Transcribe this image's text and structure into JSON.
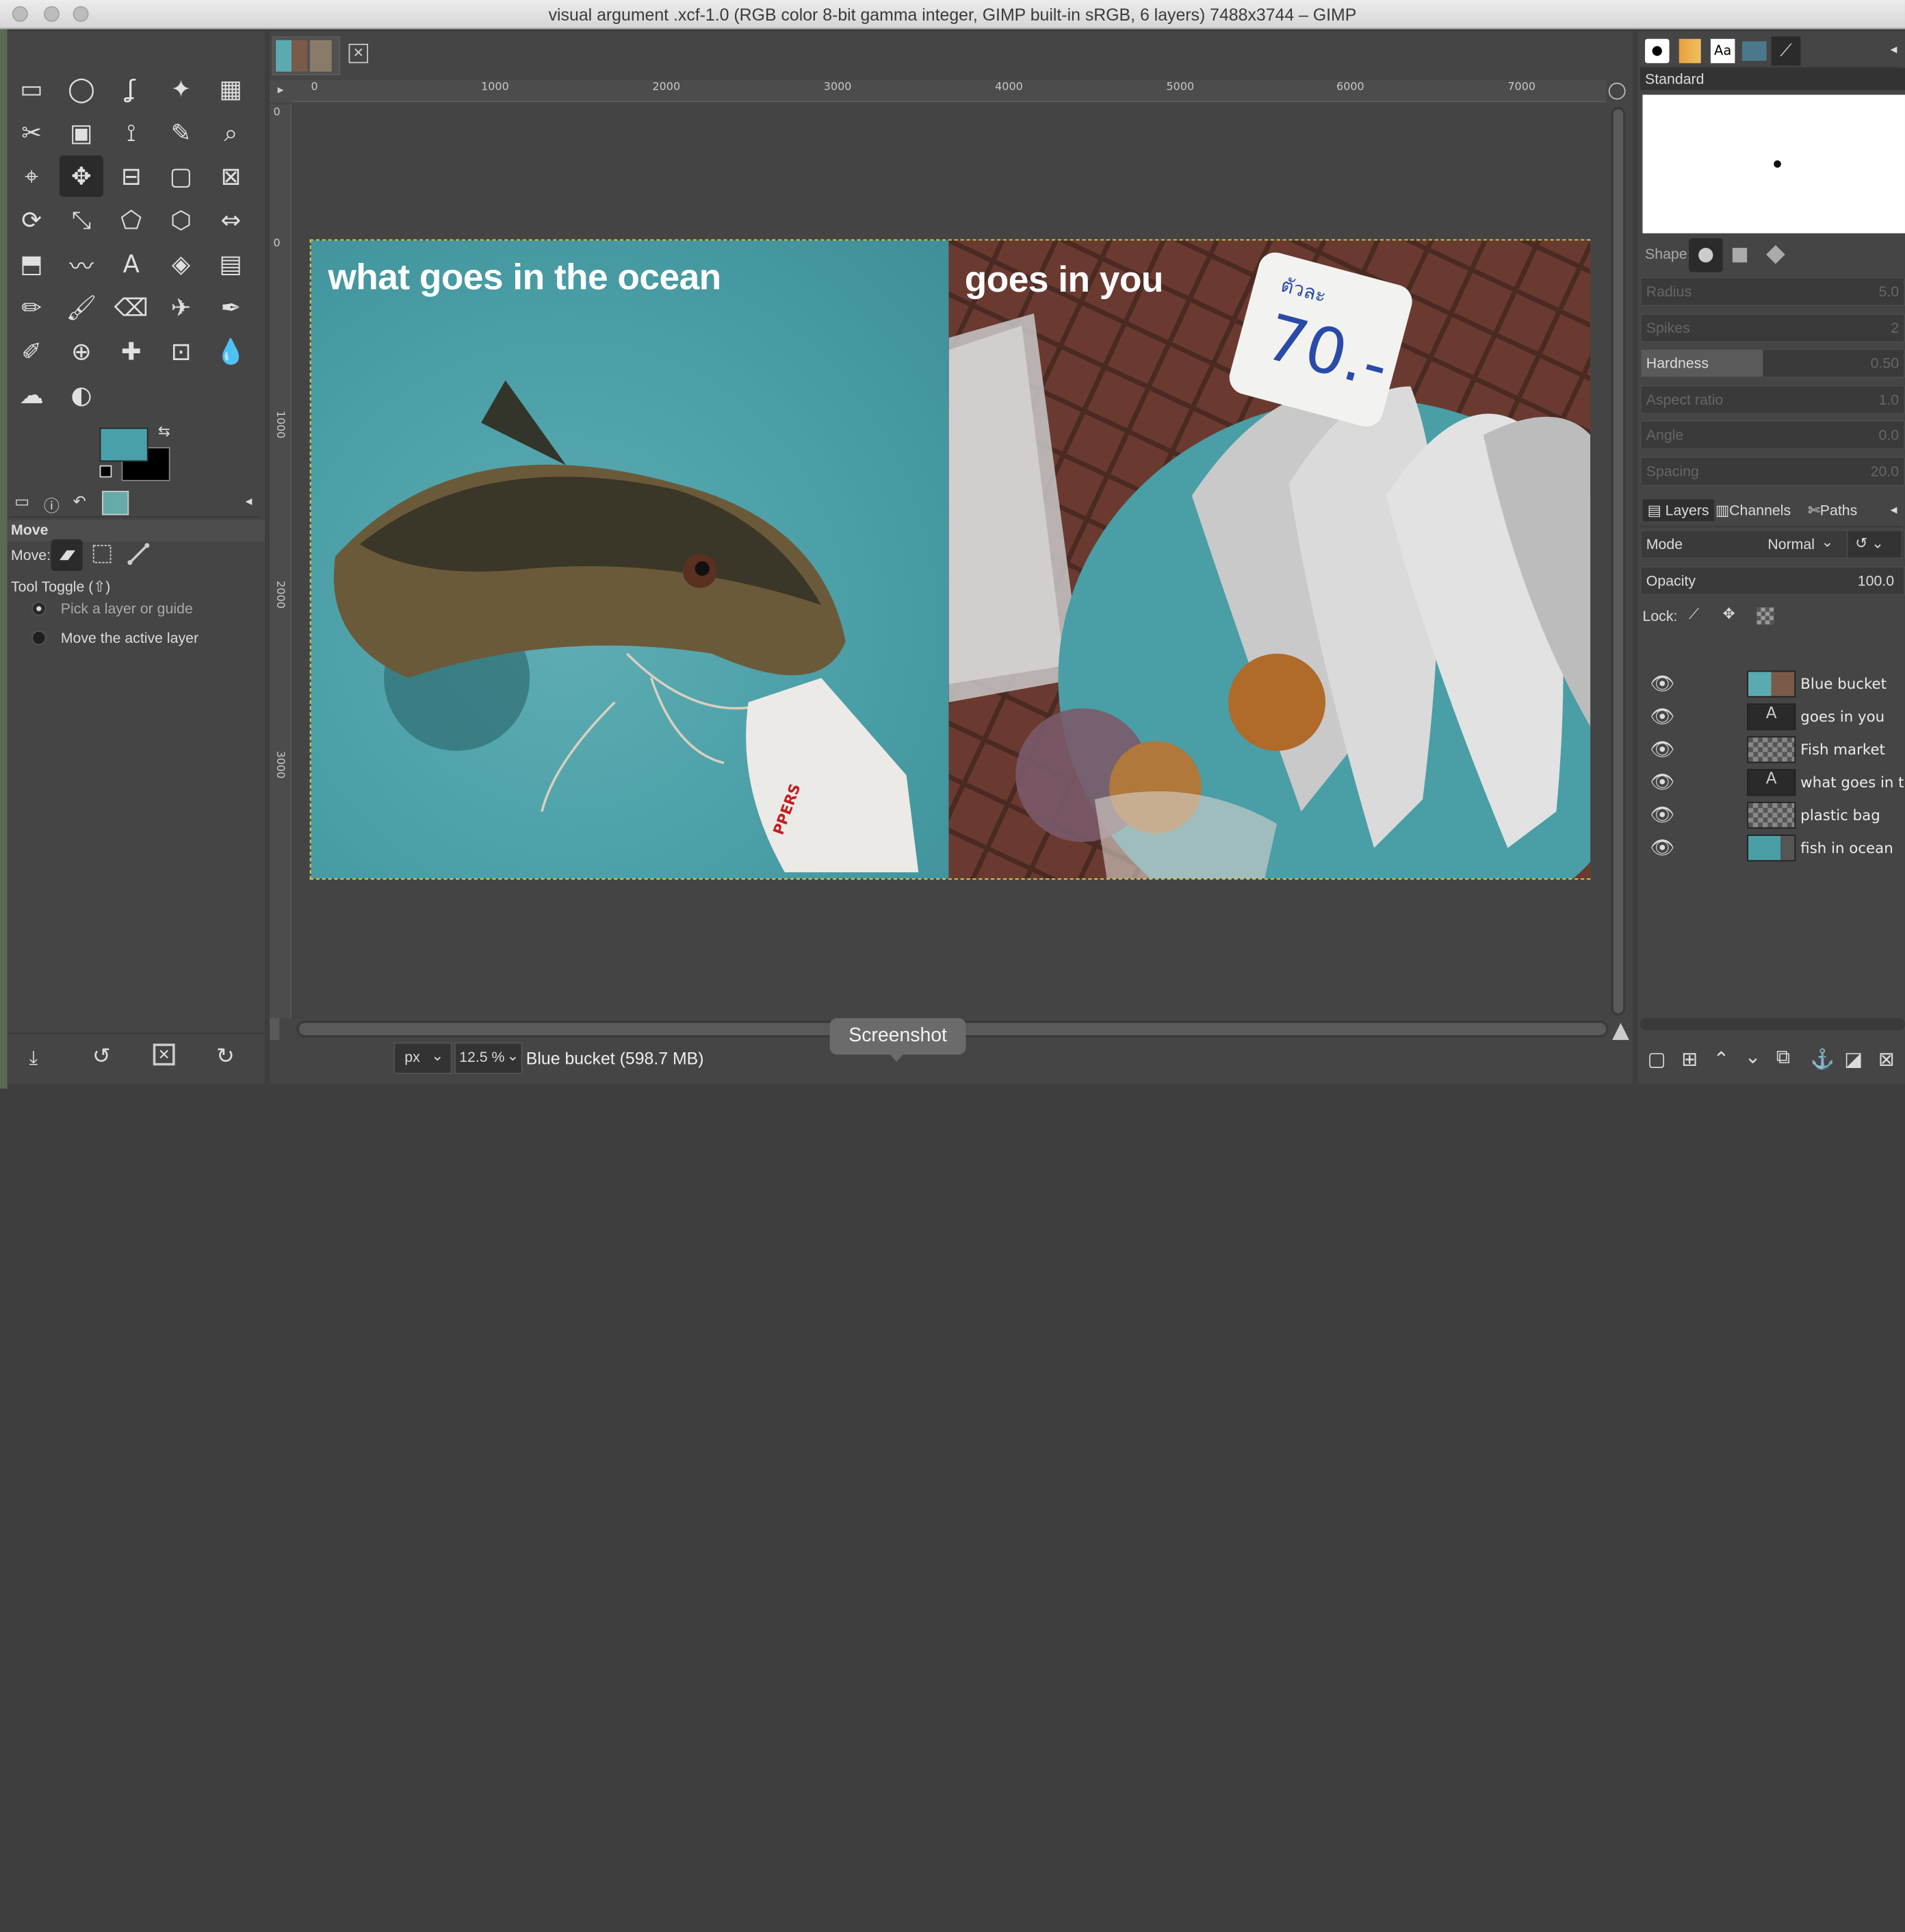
{
  "window": {
    "title": "visual argument .xcf-1.0 (RGB color 8-bit gamma integer, GIMP built-in sRGB, 6 layers) 7488x3744 – GIMP"
  },
  "ruler": {
    "h_labels": [
      "0",
      "1000",
      "2000",
      "3000",
      "4000",
      "5000",
      "6000",
      "7000"
    ],
    "v_labels": [
      "0",
      "1000",
      "2000",
      "3000"
    ]
  },
  "toolbox": {
    "tools": [
      "rect-select",
      "ellipse-select",
      "free-select",
      "fuzzy-select",
      "color-select",
      "scissors",
      "foreground-select",
      "paths",
      "color-picker",
      "zoom",
      "measure",
      "move",
      "align",
      "crop",
      "unified-transform",
      "rotate",
      "scale",
      "perspective",
      "3d-transform",
      "flip",
      "cage",
      "warp",
      "text",
      "bucket-fill",
      "blend",
      "pencil",
      "paintbrush",
      "eraser",
      "airbrush",
      "ink",
      "mypaint",
      "clone",
      "heal",
      "perspective-clone",
      "blur",
      "smudge",
      "dodge"
    ],
    "fg_color": "#4aa0a8",
    "bg_color": "#000000"
  },
  "tool_options": {
    "title": "Move",
    "move_label": "Move:",
    "toggle_label": "Tool Toggle  (⇧)",
    "options": [
      "Pick a layer or guide",
      "Move the active layer"
    ]
  },
  "canvas": {
    "left_caption": "what goes in the ocean",
    "right_caption": "goes in you",
    "price_tag": "70.-",
    "price_tag_word": "ตัวละ"
  },
  "status": {
    "unit": "px",
    "zoom": "12.5 %",
    "info": "Blue bucket (598.7 MB)"
  },
  "tooltip": "Screenshot",
  "brushes": {
    "name": "Standard",
    "shape_label": "Shape:",
    "params": [
      {
        "label": "Radius",
        "value": "5.0"
      },
      {
        "label": "Spikes",
        "value": "2"
      },
      {
        "label": "Hardness",
        "value": "0.50"
      },
      {
        "label": "Aspect ratio",
        "value": "1.0"
      },
      {
        "label": "Angle",
        "value": "0.0"
      },
      {
        "label": "Spacing",
        "value": "20.0"
      }
    ]
  },
  "layers_panel": {
    "tabs": [
      "Layers",
      "Channels",
      "Paths"
    ],
    "mode_label": "Mode",
    "mode_value": "Normal",
    "opacity_label": "Opacity",
    "opacity_value": "100.0",
    "lock_label": "Lock:",
    "layers": [
      {
        "name": "Blue bucket",
        "active": true
      },
      {
        "name": "goes in you",
        "active": false
      },
      {
        "name": "Fish market",
        "active": false
      },
      {
        "name": "what goes in the ocean",
        "active": false
      },
      {
        "name": "plastic bag",
        "active": false
      },
      {
        "name": "fish in ocean",
        "active": false
      }
    ]
  }
}
